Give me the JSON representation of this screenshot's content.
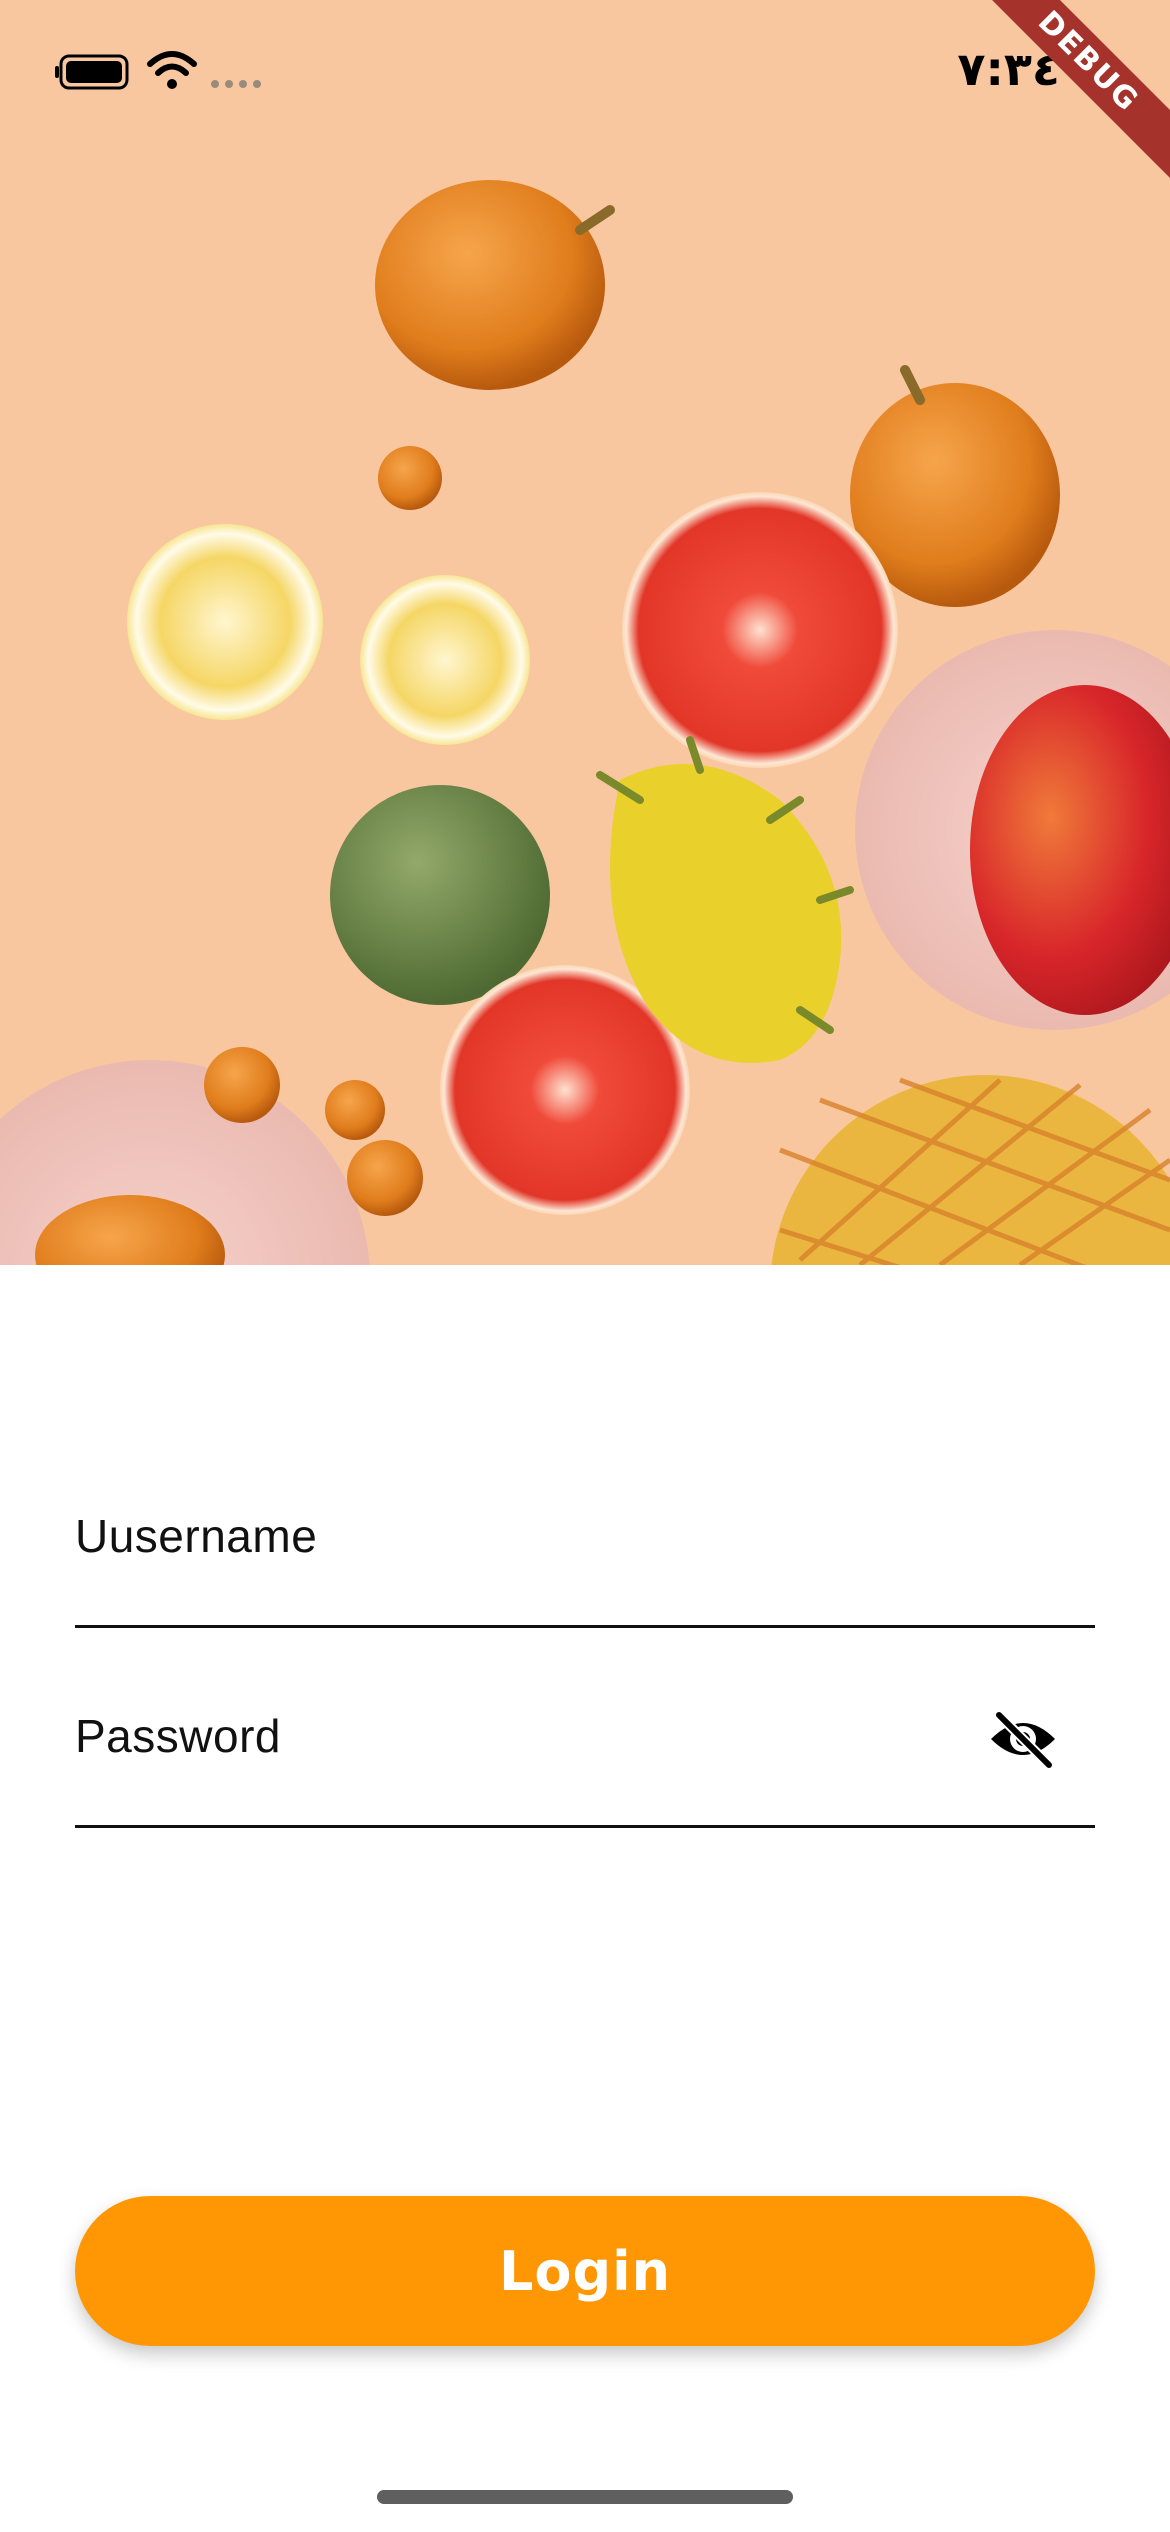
{
  "status_bar": {
    "time": "٧:٣٤",
    "icons": [
      "battery-icon",
      "wifi-icon",
      "signal-dots-icon"
    ]
  },
  "debug_banner": {
    "label": "DEBUG"
  },
  "hero": {
    "image": "fruits-photo"
  },
  "form": {
    "username_label": "Uusername",
    "password_label": "Password",
    "password_toggle_icon": "eye-off-icon"
  },
  "actions": {
    "login_label": "Login"
  },
  "colors": {
    "accent": "#ff9705",
    "hero_background": "#f8c7a0",
    "debug_banner": "#a5322b"
  }
}
